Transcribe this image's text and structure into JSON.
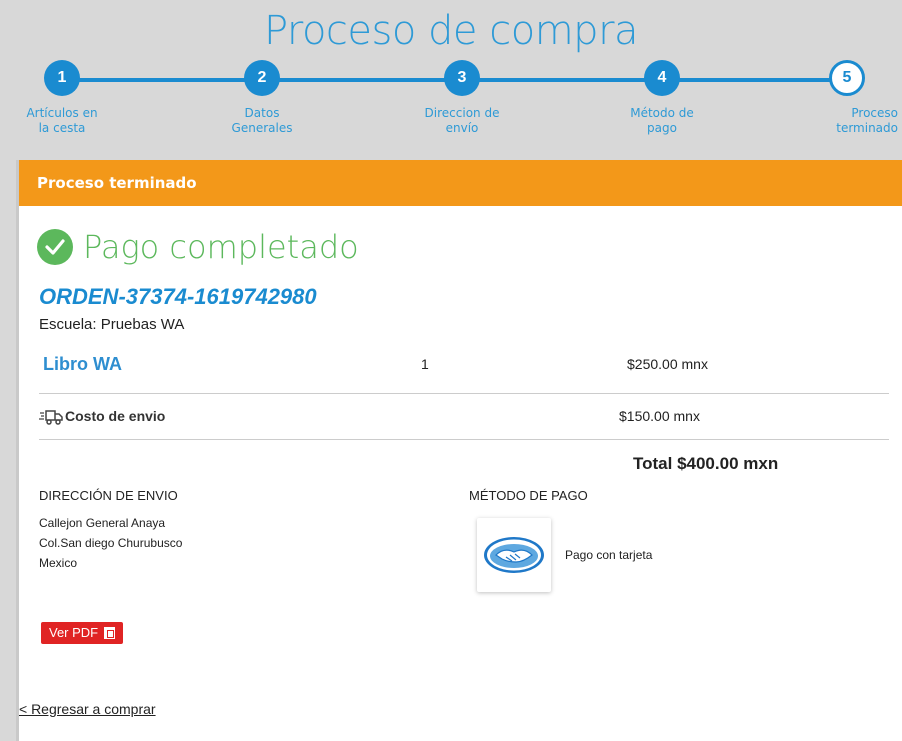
{
  "page_title": "Proceso de compra",
  "steps": [
    {
      "number": "1",
      "label_line1": "Artículos en",
      "label_line2": "la cesta"
    },
    {
      "number": "2",
      "label_line1": "Datos",
      "label_line2": "Generales"
    },
    {
      "number": "3",
      "label_line1": "Direccion de",
      "label_line2": "envío"
    },
    {
      "number": "4",
      "label_line1": "Método de",
      "label_line2": "pago"
    },
    {
      "number": "5",
      "label_line1": "Proceso",
      "label_line2": "terminado"
    }
  ],
  "panel": {
    "header": "Proceso terminado",
    "success_text": "Pago completado",
    "order_id": "ORDEN-37374-1619742980",
    "school": "Escuela: Pruebas WA",
    "item": {
      "name": "Libro WA",
      "quantity": "1",
      "price": "$250.00 mnx"
    },
    "shipping": {
      "label": "Costo de envio",
      "price": "$150.00 mnx"
    },
    "total": "Total $400.00 mxn",
    "address": {
      "title": "DIRECCIÓN DE ENVIO",
      "lines": [
        "Callejon General Anaya",
        "Col.San diego Churubusco",
        "Mexico"
      ]
    },
    "payment": {
      "title": "MÉTODO DE PAGO",
      "method": "Pago con tarjeta"
    },
    "pdf_button": "Ver PDF",
    "back_link": "< Regresar a comprar"
  },
  "colors": {
    "accent": "#1a8bd0",
    "header": "#f39819",
    "success": "#5cb85c",
    "pdf": "#e02424"
  }
}
